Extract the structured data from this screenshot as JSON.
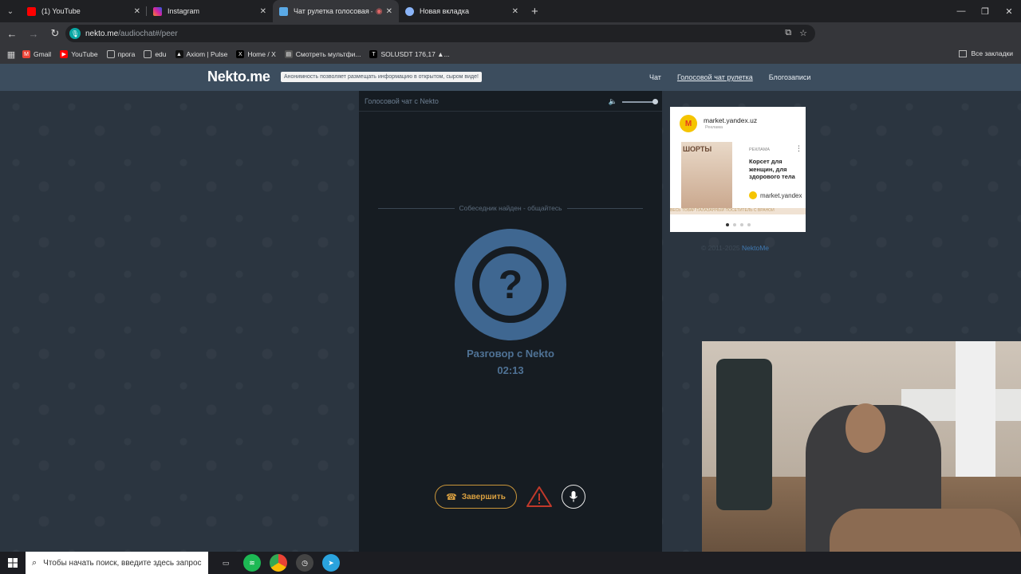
{
  "browser": {
    "tabs": [
      {
        "title": "(1) YouTube",
        "icon": "youtube-icon",
        "color": "#ff0000",
        "active": false
      },
      {
        "title": "Instagram",
        "icon": "instagram-icon",
        "color": "#d6249f",
        "active": false
      },
      {
        "title": "Чат рулетка голосовая — ",
        "icon": "nekto-icon",
        "color": "#5aa9e6",
        "active": true
      },
      {
        "title": "Новая вкладка",
        "icon": "chrome-icon",
        "color": "#8ab4f8",
        "active": false
      }
    ],
    "url_host": "nekto.me",
    "url_path": "/audiochat#/peer",
    "bookmarks": [
      {
        "label": "Gmail",
        "icon": "gmail-icon",
        "color": "#ea4335"
      },
      {
        "label": "YouTube",
        "icon": "youtube-icon",
        "color": "#ff0000"
      },
      {
        "label": "прога",
        "icon": "folder-icon",
        "color": "#35363a"
      },
      {
        "label": "edu",
        "icon": "folder-icon",
        "color": "#35363a"
      },
      {
        "label": "Axiom | Pulse",
        "icon": "axiom-icon",
        "color": "#111111"
      },
      {
        "label": "Home / X",
        "icon": "x-icon",
        "color": "#000000"
      },
      {
        "label": "Смотреть мультфи...",
        "icon": "film-icon",
        "color": "#555555"
      },
      {
        "label": "SOLUSDT 176,17 ▲...",
        "icon": "tradingview-icon",
        "color": "#000000"
      }
    ],
    "all_bookmarks": "Все закладки"
  },
  "site": {
    "logo": "Nekto.me",
    "notice": "Анонимность позволяет размещать информацию в открытом, сыром виде!",
    "nav": [
      "Чат",
      "Голосовой чат рулетка",
      "Блогозаписи"
    ]
  },
  "chat": {
    "header": "Голосовой чат с Nekto",
    "status": "Собеседник найден - общайтесь",
    "conversation_title": "Разговор с Nekto",
    "timer": "02:13",
    "end_button": "Завершить"
  },
  "ad": {
    "domain": "market.yandex.uz",
    "sub": "Реклама",
    "image_text": "ШОРТЫ",
    "label": "РЕКЛАМА",
    "title": "Корсет для женщин, для здорового тела",
    "link": "market.yandex",
    "strip": "ВЕСЬ ТОВАР ПАЛАЗАННЫЙ ПОСЕТИТЕЛЬ С ВРАНОЙ"
  },
  "footer": {
    "copyright": "© 2011-2025 ",
    "copyright_link": "NektoMe"
  },
  "taskbar": {
    "search_placeholder": "Чтобы начать поиск, введите здесь запрос"
  }
}
